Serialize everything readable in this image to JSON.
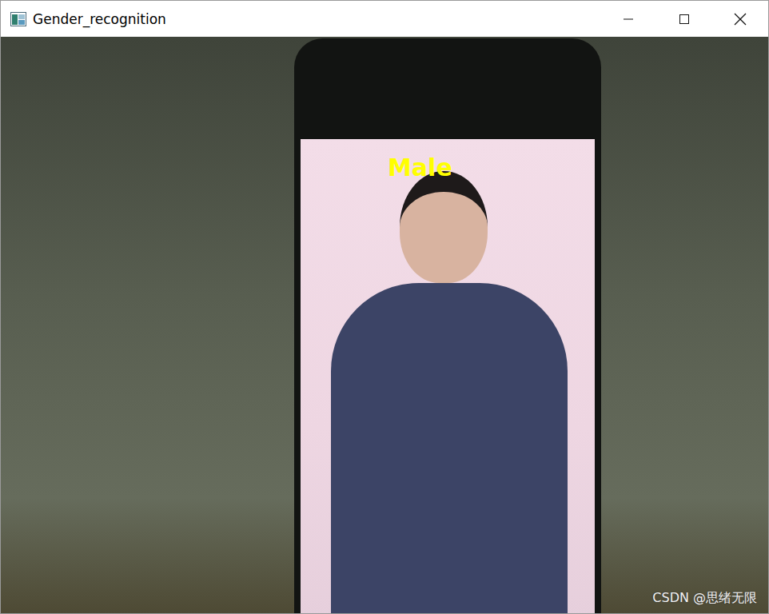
{
  "window": {
    "title": "Gender_recognition"
  },
  "detections": [
    {
      "label": "Male"
    }
  ],
  "watermark": "CSDN @思绪无限"
}
